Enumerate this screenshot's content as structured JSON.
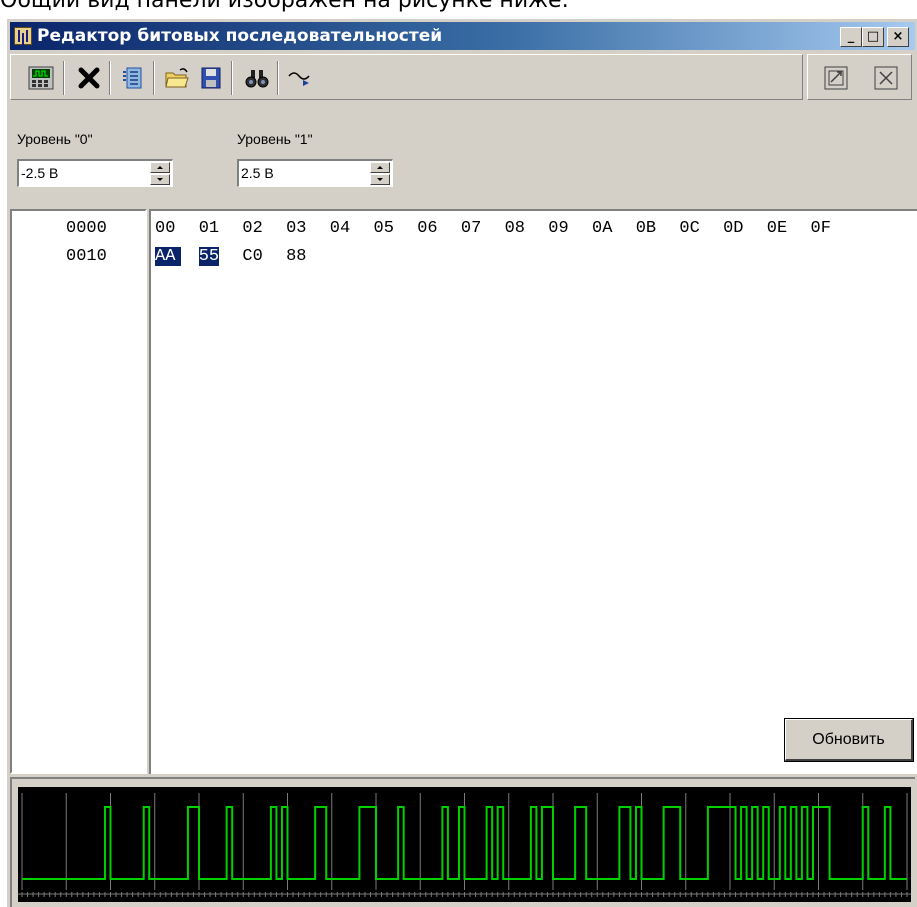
{
  "caption": "Общий вид панели изображен на рисунке ниже:",
  "window": {
    "title": "Редактор битовых последовательностей",
    "buttons": {
      "minimize": "_",
      "maximize": "□",
      "close": "×"
    }
  },
  "toolbar": {
    "icons": [
      "generator-icon",
      "delete-icon",
      "list-icon",
      "open-folder-icon",
      "save-icon",
      "binoculars-icon",
      "signal-icon"
    ],
    "right_icons": [
      "export-icon",
      "close-panel-icon"
    ]
  },
  "levels": {
    "level0": {
      "label": "Уровень \"0\"",
      "value": "-2.5 В"
    },
    "level1": {
      "label": "Уровень \"1\"",
      "value": "2.5 В"
    }
  },
  "addresses": [
    "0000",
    "0010"
  ],
  "rows": [
    [
      "00",
      "01",
      "02",
      "03",
      "04",
      "05",
      "06",
      "07",
      "08",
      "09",
      "0A",
      "0B",
      "0C",
      "0D",
      "0E",
      "0F"
    ],
    [
      "AA",
      "55",
      "C0",
      "88"
    ]
  ],
  "selection": {
    "row": 1,
    "count": 2
  },
  "refresh_label": "Обновить",
  "colors": {
    "signal": "#00d000",
    "grid": "#7a7a7a",
    "selection": "#0a246a",
    "title_start": "#0a246a",
    "title_end": "#a6caf0"
  }
}
